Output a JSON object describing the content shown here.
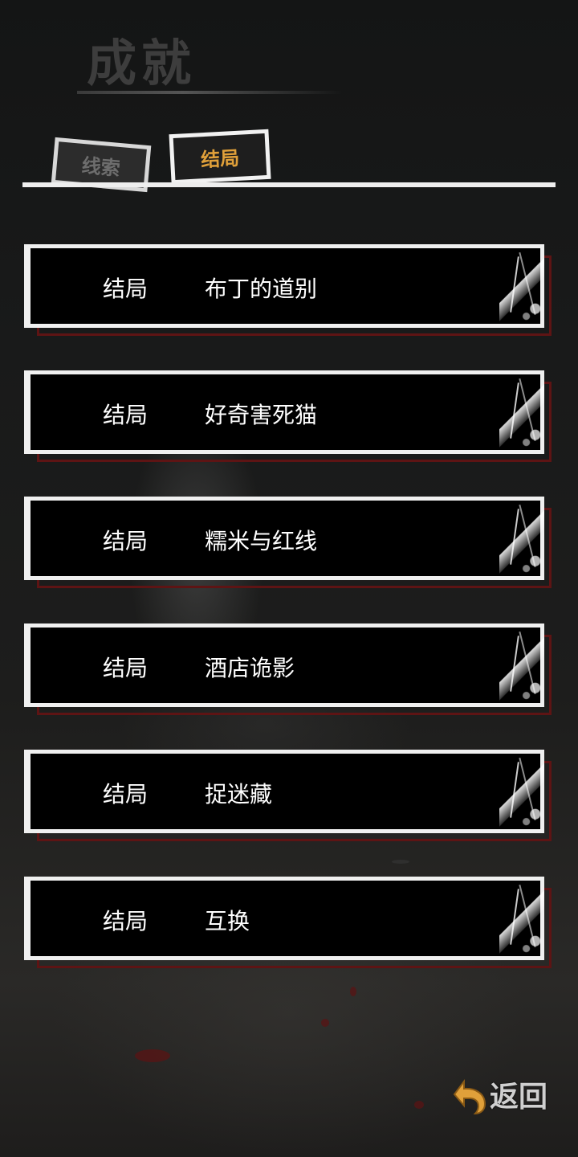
{
  "header": {
    "title": "成就"
  },
  "tabs": [
    {
      "label": "线索",
      "active": false
    },
    {
      "label": "结局",
      "active": true
    }
  ],
  "endings": [
    {
      "type": "结局",
      "name": "布丁的道别"
    },
    {
      "type": "结局",
      "name": "好奇害死猫"
    },
    {
      "type": "结局",
      "name": "糯米与红线"
    },
    {
      "type": "结局",
      "name": "酒店诡影"
    },
    {
      "type": "结局",
      "name": "捉迷藏"
    },
    {
      "type": "结局",
      "name": "互换"
    }
  ],
  "footer": {
    "back_label": "返回",
    "back_icon": "return-arrow-icon"
  },
  "colors": {
    "background": "#151515",
    "active_tab_text": "#e0a03a",
    "inactive_tab_text": "#6d6d6d",
    "card_shadow": "#5e1414",
    "back_icon": "#e0a03a"
  }
}
